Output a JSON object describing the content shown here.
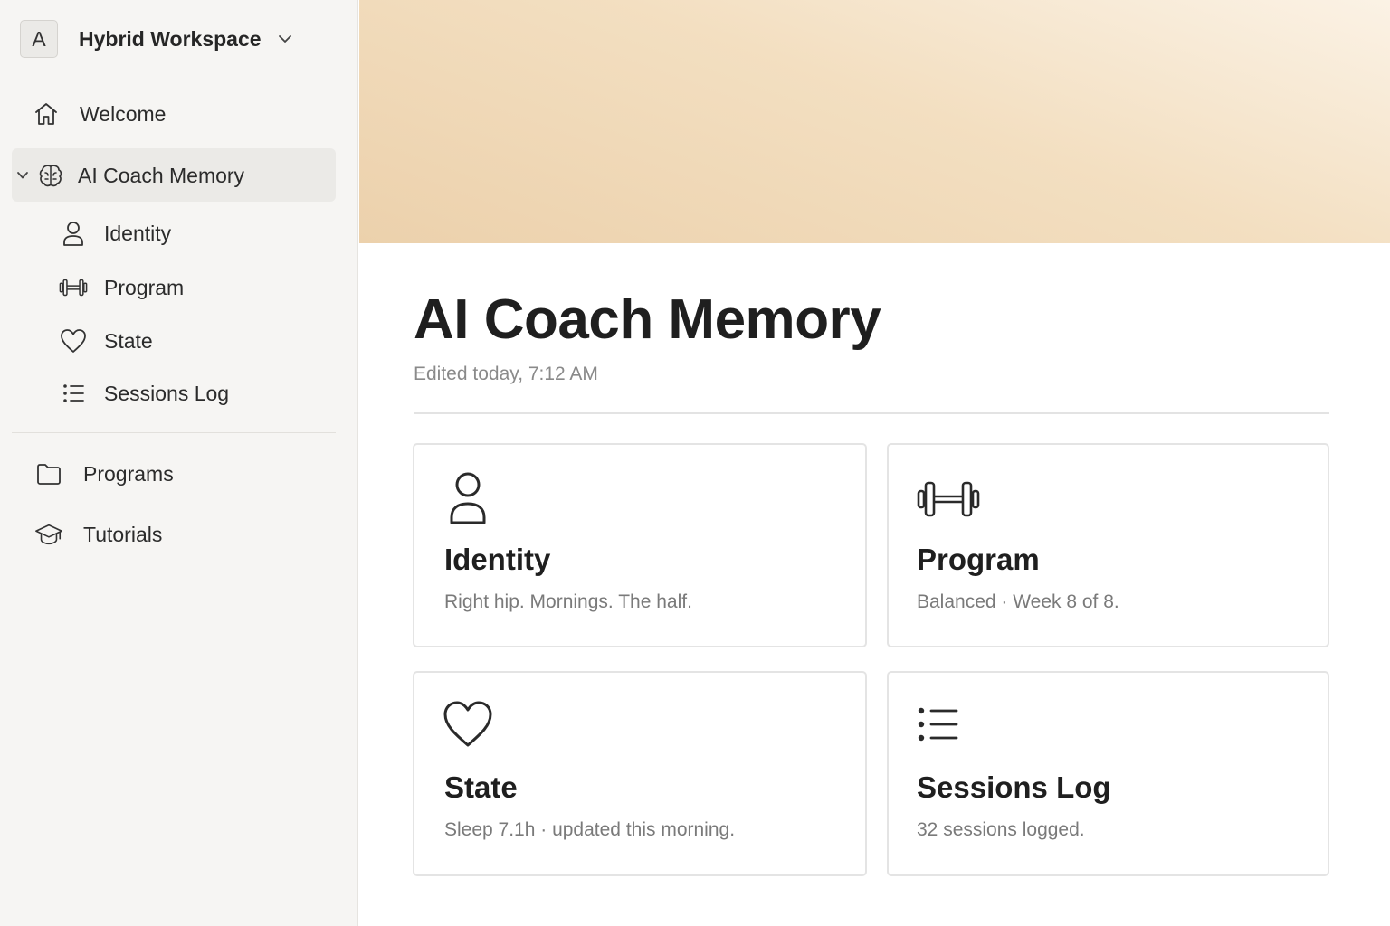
{
  "workspace": {
    "avatar_letter": "A",
    "name": "Hybrid Workspace"
  },
  "sidebar": {
    "items": [
      {
        "label": "Welcome",
        "icon": "home-icon"
      },
      {
        "label": "AI Coach Memory",
        "icon": "brain-icon",
        "expanded": true,
        "active": true
      },
      {
        "label": "Identity",
        "icon": "person-icon"
      },
      {
        "label": "Program",
        "icon": "dumbbell-icon"
      },
      {
        "label": "State",
        "icon": "heart-icon"
      },
      {
        "label": "Sessions Log",
        "icon": "list-icon"
      },
      {
        "label": "Programs",
        "icon": "folder-icon"
      },
      {
        "label": "Tutorials",
        "icon": "graduation-cap-icon"
      }
    ]
  },
  "page": {
    "title": "AI Coach Memory",
    "edited": "Edited today, 7:12 AM",
    "cover_colors": [
      "#fbf2e5",
      "#ecd1ac"
    ]
  },
  "cards": [
    {
      "title": "Identity",
      "subtitle": "Right hip. Mornings. The half.",
      "icon": "person-icon"
    },
    {
      "title": "Program",
      "subtitle": "Balanced · Week 8 of 8.",
      "icon": "dumbbell-icon"
    },
    {
      "title": "State",
      "subtitle": "Sleep 7.1h · updated this morning.",
      "icon": "heart-icon"
    },
    {
      "title": "Sessions Log",
      "subtitle": "32 sessions logged.",
      "icon": "list-icon"
    }
  ]
}
